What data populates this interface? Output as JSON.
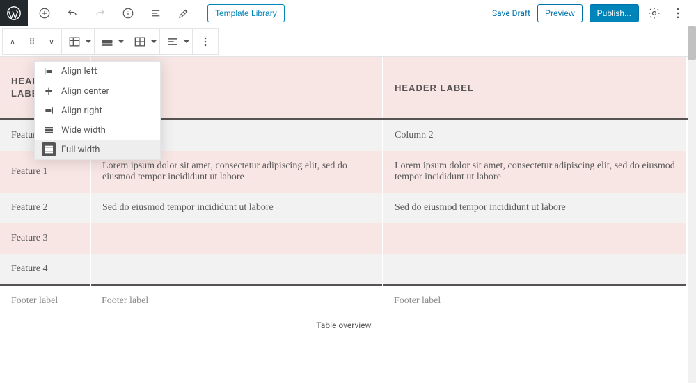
{
  "topbar": {
    "template_library": "Template Library",
    "save_draft": "Save Draft",
    "preview": "Preview",
    "publish": "Publish..."
  },
  "align_menu": {
    "items": [
      {
        "label": "Align left"
      },
      {
        "label": "Align center"
      },
      {
        "label": "Align right"
      },
      {
        "label": "Wide width"
      },
      {
        "label": "Full width"
      }
    ]
  },
  "table": {
    "headers": {
      "c0": "HEADER LABEL",
      "c2": "HEADER LABEL"
    },
    "rows": [
      {
        "c0": "Feature",
        "c1": "",
        "c2": "Column 2"
      },
      {
        "c0": "Feature 1",
        "c1": "Lorem ipsum dolor sit amet, consectetur adipiscing elit, sed do eiusmod tempor incididunt ut labore",
        "c2": "Lorem ipsum dolor sit amet, consectetur adipiscing elit, sed do eiusmod tempor incididunt ut labore"
      },
      {
        "c0": "Feature 2",
        "c1": "Sed do eiusmod tempor incididunt ut labore",
        "c2": "Sed do eiusmod tempor incididunt ut labore"
      },
      {
        "c0": "Feature 3",
        "c1": "",
        "c2": ""
      },
      {
        "c0": "Feature 4",
        "c1": "",
        "c2": ""
      }
    ],
    "footer": {
      "c0": "Footer label",
      "c1": "Footer label",
      "c2": "Footer label"
    },
    "caption": "Table overview"
  }
}
